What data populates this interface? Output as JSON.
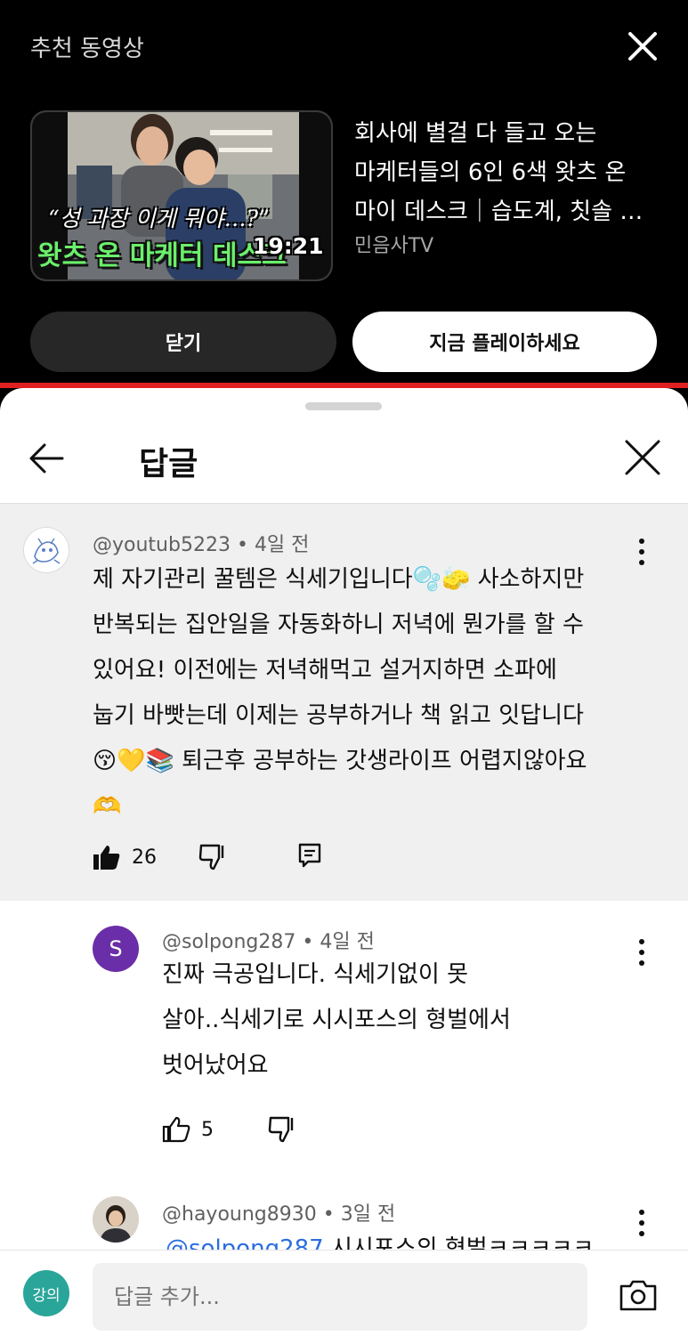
{
  "recommended": {
    "title": "추천 동영상",
    "thumbnail_caption_line1": "“성 과장 이게 뭐야…?”",
    "thumbnail_caption_line2": "왓츠 온 마케터 데스크",
    "duration": "19:21",
    "video_title_lines": [
      "회사에 별걸 다 들고 오는",
      "마케터들의 6인 6색 왓츠 온",
      "마이 데스크｜습도계, 칫솔 …"
    ],
    "channel": "민음사TV",
    "close_label": "닫기",
    "play_label": "지금 플레이하세요"
  },
  "sheet": {
    "title": "답글"
  },
  "parent_comment": {
    "author": "@youtub5223",
    "time": "4일 전",
    "lines": [
      "제 자기관리 꿀템은 식세기입니다🫧🧽 사소하지만",
      "반복되는 집안일을 자동화하니 저녁에 뭔가를 할 수",
      "있어요! 이전에는 저녁해먹고 설거지하면 소파에",
      "눕기 바빳는데 이제는 공부하거나 책 읽고 잇답니다",
      "😚💛📚 퇴근후 공부하는 갓생라이프 어렵지않아요",
      "🫶"
    ],
    "likes": "26"
  },
  "replies": [
    {
      "author": "@solpong287",
      "time": "4일 전",
      "avatar_letter": "S",
      "lines": [
        "진짜 극공입니다. 식세기없이 못",
        "살아..식세기로 시시포스의 형벌에서",
        "벗어났어요"
      ],
      "likes": "5"
    },
    {
      "author": "@hayoung8930",
      "time": "3일 전",
      "mention": "@solpong287",
      "text_after_mention": " 시시포스의 형벌ㅋㅋㅋㅋㅋ"
    }
  ],
  "reply_input": {
    "avatar_text": "강의",
    "placeholder": "답글 추가..."
  },
  "colors": {
    "accent_red": "#e02020",
    "reply_avatar_purple": "#6a2ea8",
    "my_avatar_teal": "#2aa59a",
    "mention_blue": "#2b6de0"
  }
}
